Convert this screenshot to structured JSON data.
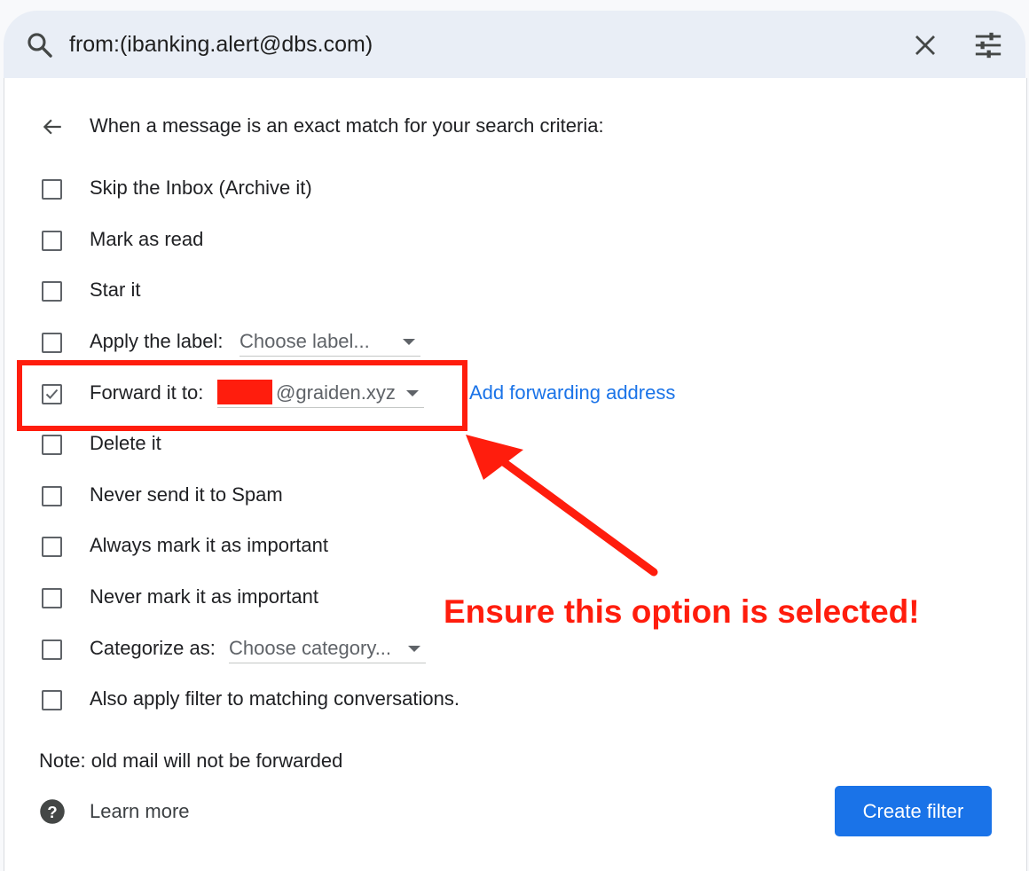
{
  "search": {
    "query": "from:(ibanking.alert@dbs.com)"
  },
  "filter": {
    "header": "When a message is an exact match for your search criteria:",
    "options": [
      {
        "label": "Skip the Inbox (Archive it)",
        "checked": false
      },
      {
        "label": "Mark as read",
        "checked": false
      },
      {
        "label": "Star it",
        "checked": false
      },
      {
        "label": "Apply the label:",
        "checked": false,
        "select_value": "Choose label..."
      },
      {
        "label": "Forward it to:",
        "checked": true,
        "select_value": "@graiden.xyz",
        "link": "Add forwarding address"
      },
      {
        "label": "Delete it",
        "checked": false
      },
      {
        "label": "Never send it to Spam",
        "checked": false
      },
      {
        "label": "Always mark it as important",
        "checked": false
      },
      {
        "label": "Never mark it as important",
        "checked": false
      },
      {
        "label": "Categorize as:",
        "checked": false,
        "select_value": "Choose category..."
      },
      {
        "label": "Also apply filter to matching conversations.",
        "checked": false
      }
    ],
    "note": "Note: old mail will not be forwarded",
    "learn_more": "Learn more",
    "create_button": "Create filter"
  },
  "annotation": {
    "text": "Ensure this option is selected!",
    "color": "#ff1d0d"
  },
  "colors": {
    "accent": "#1a73e8",
    "annotation": "#ff1d0d"
  },
  "icons": [
    "search-icon",
    "close-icon",
    "tune-icon",
    "arrow-back-icon",
    "check-icon",
    "help-icon",
    "dropdown-caret-icon"
  ]
}
